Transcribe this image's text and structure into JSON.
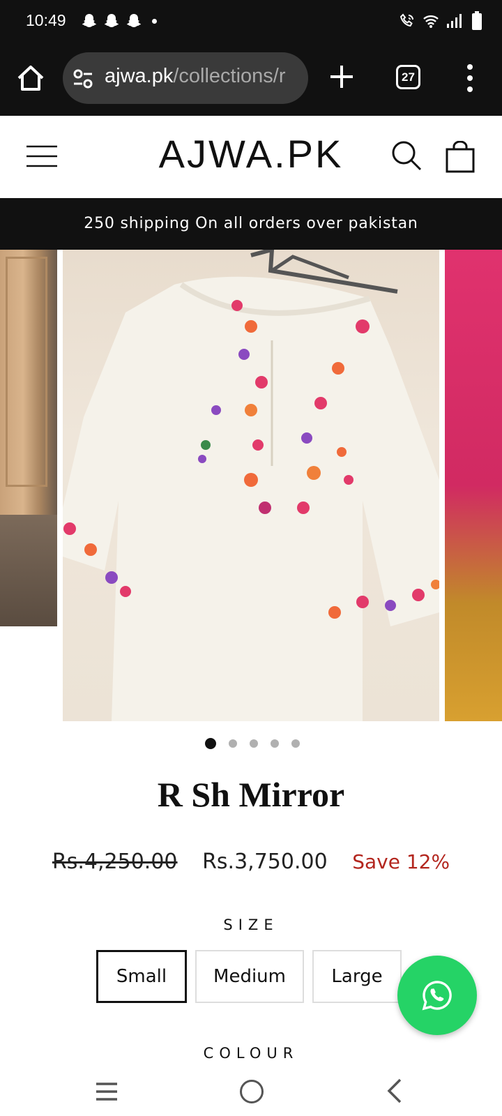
{
  "status": {
    "time": "10:49",
    "icons_left": [
      "snapchat-icon",
      "snapchat-icon",
      "snapchat-icon",
      "dot-icon"
    ],
    "icons_right": [
      "wifi-call-icon",
      "wifi-icon",
      "signal-icon",
      "battery-icon"
    ]
  },
  "browser": {
    "url_host": "ajwa.pk",
    "url_path": "/collections/r",
    "tab_count": "27"
  },
  "site": {
    "logo": "AJWA.PK",
    "announcement": "250 shipping On all orders over pakistan"
  },
  "gallery": {
    "slide_count": 5,
    "active_index": 0
  },
  "product": {
    "title": "R Sh Mirror",
    "price_original": "Rs.4,250.00",
    "price_sale": "Rs.3,750.00",
    "save_text": "Save 12%",
    "size_label": "SIZE",
    "sizes": [
      "Small",
      "Medium",
      "Large"
    ],
    "selected_size": "Small",
    "colour_label": "COLOUR"
  },
  "colors": {
    "accent_sale": "#b3261e",
    "whatsapp": "#25d366"
  }
}
